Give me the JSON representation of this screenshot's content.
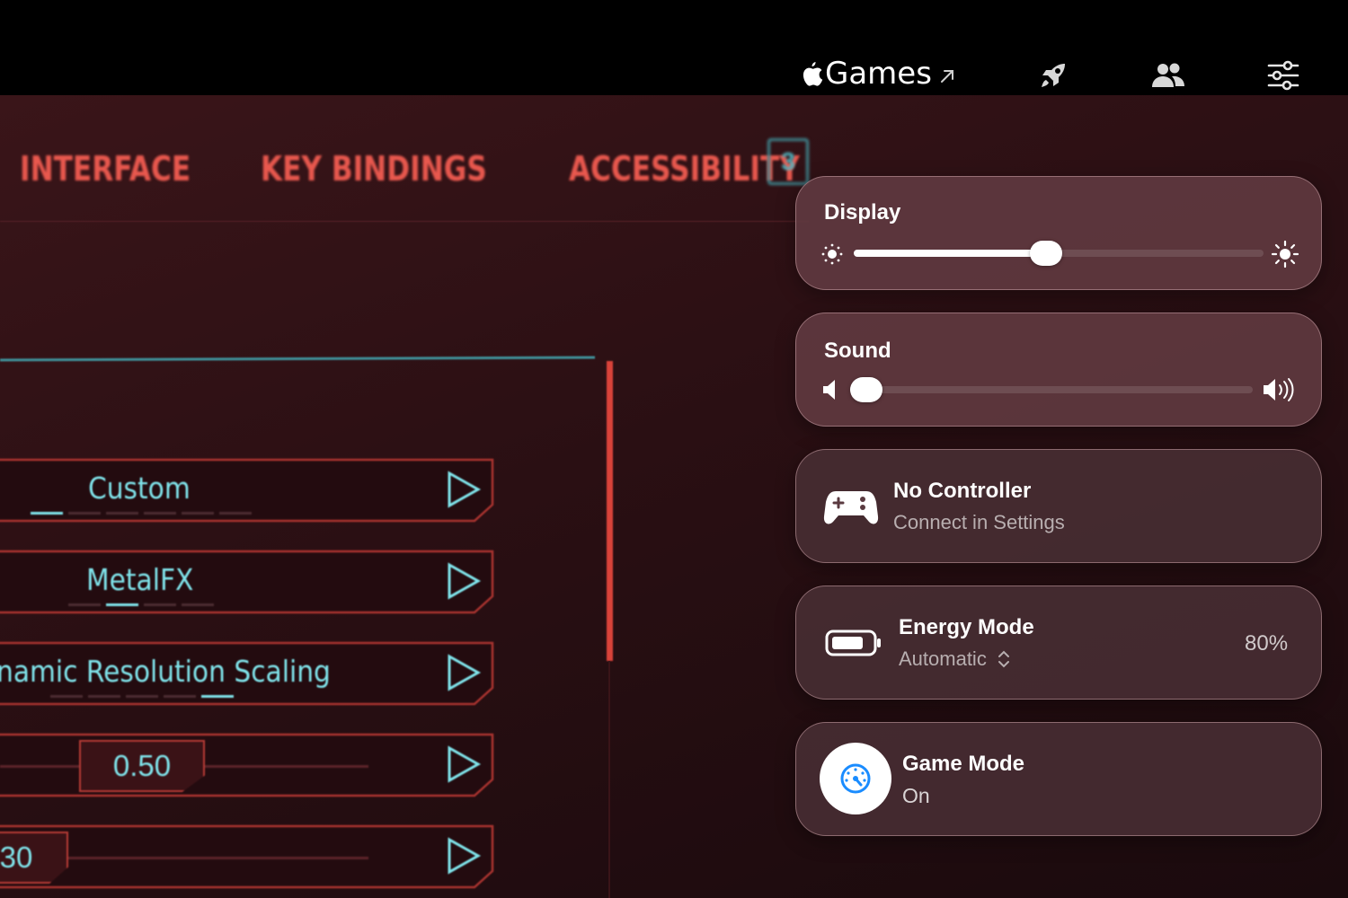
{
  "topbar": {
    "title": "Games",
    "icons": [
      "apple-logo-icon",
      "external-arrow-icon",
      "rocket-icon",
      "friends-icon",
      "settings-sliders-icon"
    ]
  },
  "game": {
    "tabs": [
      "INTERFACE",
      "KEY BINDINGS",
      "ACCESSIBILITY"
    ],
    "tab_badge": "3",
    "options": [
      {
        "label": "Custom"
      },
      {
        "label": "MetalFX"
      },
      {
        "label": "namic Resolution Scaling"
      },
      {
        "label": "0.50"
      },
      {
        "label": "30"
      }
    ],
    "colors": {
      "accent_red": "#e8584e",
      "accent_teal": "#7fe3ea"
    }
  },
  "panel": {
    "display": {
      "title": "Display",
      "level": 0.47
    },
    "sound": {
      "title": "Sound",
      "level": 0.04
    },
    "controller": {
      "title": "No Controller",
      "subtitle": "Connect in Settings"
    },
    "energy": {
      "title": "Energy Mode",
      "subtitle": "Automatic",
      "battery": "80%"
    },
    "game_mode": {
      "title": "Game Mode",
      "status": "On",
      "accent": "#1a8cff"
    }
  }
}
